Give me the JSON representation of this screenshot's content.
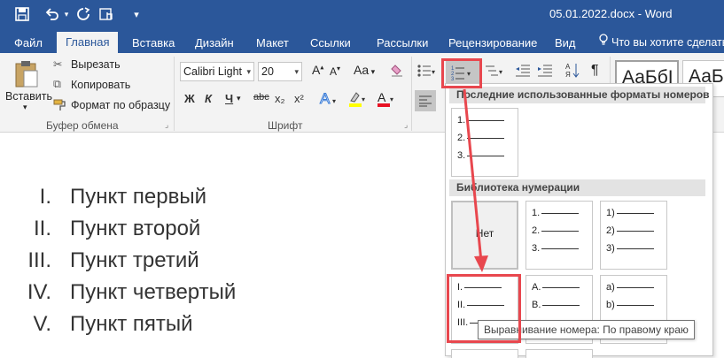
{
  "window": {
    "title": "05.01.2022.docx - Word"
  },
  "quick_access": {
    "save_icon": "save-icon",
    "undo_icon": "undo-icon",
    "redo_icon": "redo-icon",
    "touch_icon": "touch-mode-icon",
    "customize_icon": "customize-icon"
  },
  "ribbon_tabs": [
    "Файл",
    "Главная",
    "Вставка",
    "Дизайн",
    "Макет",
    "Ссылки",
    "Рассылки",
    "Рецензирование",
    "Вид"
  ],
  "tell_me": "Что вы хотите сделать?",
  "clipboard": {
    "paste": "Вставить",
    "cut": "Вырезать",
    "copy": "Копировать",
    "format_painter": "Формат по образцу",
    "group_label": "Буфер обмена"
  },
  "font": {
    "name": "Calibri Light",
    "size": "20",
    "group_label": "Шрифт",
    "bold": "Ж",
    "italic": "К",
    "underline": "Ч",
    "strike": "abc",
    "subscript": "x₂",
    "superscript": "x²",
    "grow": "Aa"
  },
  "styles": {
    "sample1": "АаБбI",
    "sample2": "АаБ"
  },
  "document": {
    "items": [
      {
        "num": "I.",
        "text": "Пункт первый"
      },
      {
        "num": "II.",
        "text": "Пункт второй"
      },
      {
        "num": "III.",
        "text": "Пункт третий"
      },
      {
        "num": "IV.",
        "text": "Пункт четвертый"
      },
      {
        "num": "V.",
        "text": "Пункт пятый"
      }
    ]
  },
  "numbering_menu": {
    "recent_header": "Последние использованные форматы номеров",
    "library_header": "Библиотека нумерации",
    "recent": [
      {
        "lines": [
          "1.",
          "2.",
          "3."
        ]
      }
    ],
    "none_label": "Нет",
    "library": [
      {
        "lines": [
          "1.",
          "2.",
          "3."
        ]
      },
      {
        "lines": [
          "1)",
          "2)",
          "3)"
        ]
      },
      {
        "lines": [
          "I.",
          "II.",
          "III."
        ]
      },
      {
        "lines": [
          "A.",
          "B.",
          ""
        ]
      },
      {
        "lines": [
          "a)",
          "b)",
          ""
        ]
      }
    ],
    "tooltip": "Выравнивание номера: По правому краю"
  },
  "colors": {
    "brand": "#2b579a",
    "highlight": "#e8474e",
    "ribbon_bg": "#f3f3f3"
  }
}
